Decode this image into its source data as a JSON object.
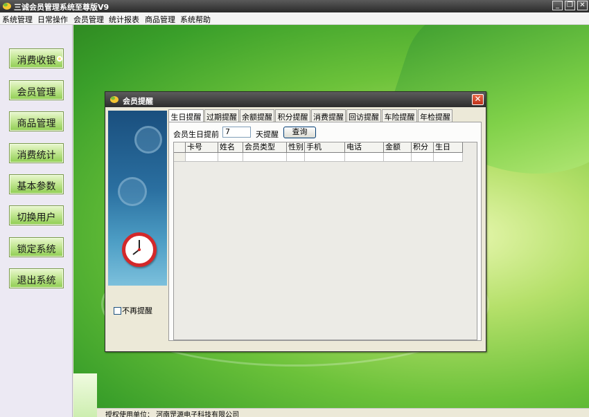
{
  "app": {
    "title": "三诚会员管理系统至尊版V9",
    "window_buttons": {
      "minimize": "_",
      "restore": "❐",
      "close": "✕"
    }
  },
  "menu": [
    "系统管理",
    "日常操作",
    "会员管理",
    "统计报表",
    "商品管理",
    "系统帮助"
  ],
  "sidebar": {
    "buttons": [
      "消费收银",
      "会员管理",
      "商品管理",
      "消费统计",
      "基本参数",
      "切换用户",
      "锁定系统",
      "退出系统"
    ]
  },
  "status": {
    "text": "授权使用单位：  河南罡源电子科技有限公司"
  },
  "dialog": {
    "title": "会员提醒",
    "close": "✕",
    "tabs": [
      "生日提醒",
      "过期提醒",
      "余额提醒",
      "积分提醒",
      "消费提醒",
      "回访提醒",
      "车险提醒",
      "年检提醒"
    ],
    "active_tab": 0,
    "birthday": {
      "prefix_label": "会员生日提前",
      "days_value": "7",
      "suffix_label": "天提醒",
      "query_label": "查询"
    },
    "table": {
      "columns": [
        "卡号",
        "姓名",
        "会员类型",
        "性别",
        "手机",
        "电话",
        "金额",
        "积分",
        "生日"
      ],
      "rows": []
    },
    "no_more_reminder": {
      "label": "不再提醒",
      "checked": false
    }
  },
  "colors": {
    "accent_green": "#8fcd52",
    "dialog_close": "#c0321a",
    "clock_red": "#d3282a"
  }
}
